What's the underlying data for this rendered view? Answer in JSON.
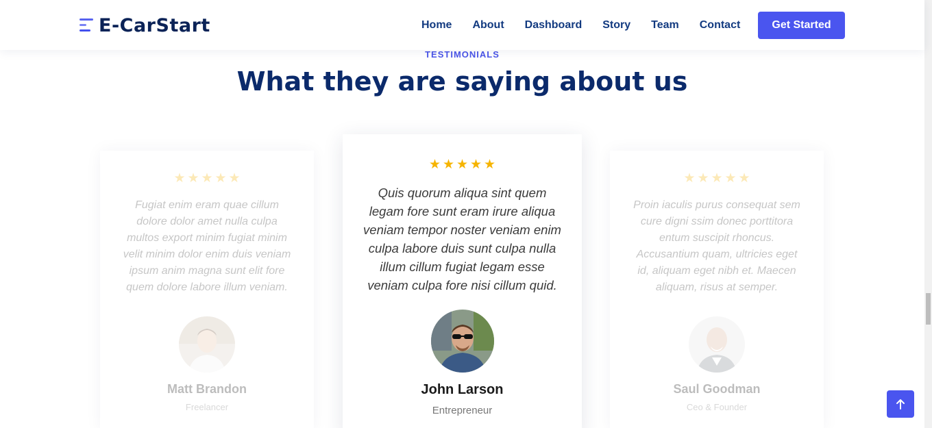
{
  "header": {
    "logo_text": "E-CarStart",
    "nav": [
      "Home",
      "About",
      "Dashboard",
      "Story",
      "Team",
      "Contact"
    ],
    "cta_label": "Get Started"
  },
  "section": {
    "eyebrow": "TESTIMONIALS",
    "title": "What they are saying about us"
  },
  "testimonials": [
    {
      "rating": 5,
      "quote": "Fugiat enim eram quae cillum dolore dolor amet nulla culpa multos export minim fugiat minim velit minim dolor enim duis veniam ipsum anim magna sunt elit fore quem dolore labore illum veniam.",
      "name": "Matt Brandon",
      "role": "Freelancer"
    },
    {
      "rating": 5,
      "quote": "Quis quorum aliqua sint quem legam fore sunt eram irure aliqua veniam tempor noster veniam enim culpa labore duis sunt culpa nulla illum cillum fugiat legam esse veniam culpa fore nisi cillum quid.",
      "name": "John Larson",
      "role": "Entrepreneur"
    },
    {
      "rating": 5,
      "quote": "Proin iaculis purus consequat sem cure digni ssim donec porttitora entum suscipit rhoncus. Accusantium quam, ultricies eget id, aliquam eget nibh et. Maecen aliquam, risus at semper.",
      "name": "Saul Goodman",
      "role": "Ceo & Founder"
    }
  ],
  "colors": {
    "accent": "#4a55ef",
    "heading": "#0b2a6b",
    "star": "#f6b400"
  },
  "icons": {
    "star": "star-icon",
    "scroll_top": "arrow-up-icon"
  }
}
